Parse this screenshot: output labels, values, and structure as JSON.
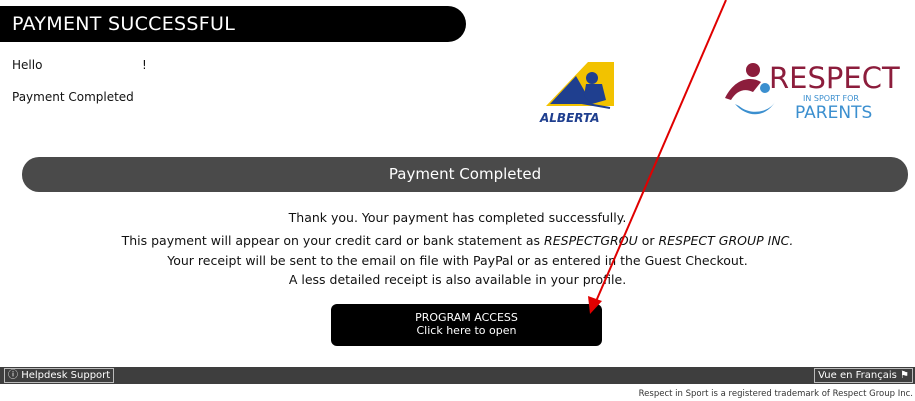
{
  "header": {
    "title": "PAYMENT SUCCESSFUL"
  },
  "greeting": {
    "hello": "Hello",
    "exclamation": "!"
  },
  "status_note": "Payment Completed",
  "logos": {
    "alberta_text": "ALBERTA",
    "respect_text": "RESPECT",
    "respect_sub": "IN SPORT FOR",
    "respect_parents": "PARENTS"
  },
  "section": {
    "title": "Payment Completed"
  },
  "message": {
    "line1": "Thank you. Your payment has completed successfully.",
    "line2_prefix": "This payment will appear on your credit card or bank statement as ",
    "line2_name1": "RESPECTGROU",
    "line2_mid": " or ",
    "line2_name2": "RESPECT GROUP INC.",
    "line3": "Your receipt will be sent to the email on file with PayPal or as entered in the Guest Checkout.",
    "line4": "A less detailed receipt is also available in your profile."
  },
  "program_access": {
    "title": "PROGRAM ACCESS",
    "subtitle": "Click here to open"
  },
  "footer": {
    "helpdesk_icon": "info-icon",
    "helpdesk_label": "Helpdesk Support",
    "french_label": "Vue en Français",
    "french_icon": "flag-icon"
  },
  "trademark": "Respect in Sport is a registered trademark of Respect Group Inc.",
  "colors": {
    "header_bg": "#000000",
    "section_bg": "#4a4a4a",
    "footer_bg": "#3e3e3e",
    "annotation_arrow": "#e00000",
    "alberta_blue": "#1f3f8f",
    "alberta_gold": "#f2c200",
    "respect_maroon": "#8c1d3c",
    "respect_blue": "#3b8fcf"
  }
}
